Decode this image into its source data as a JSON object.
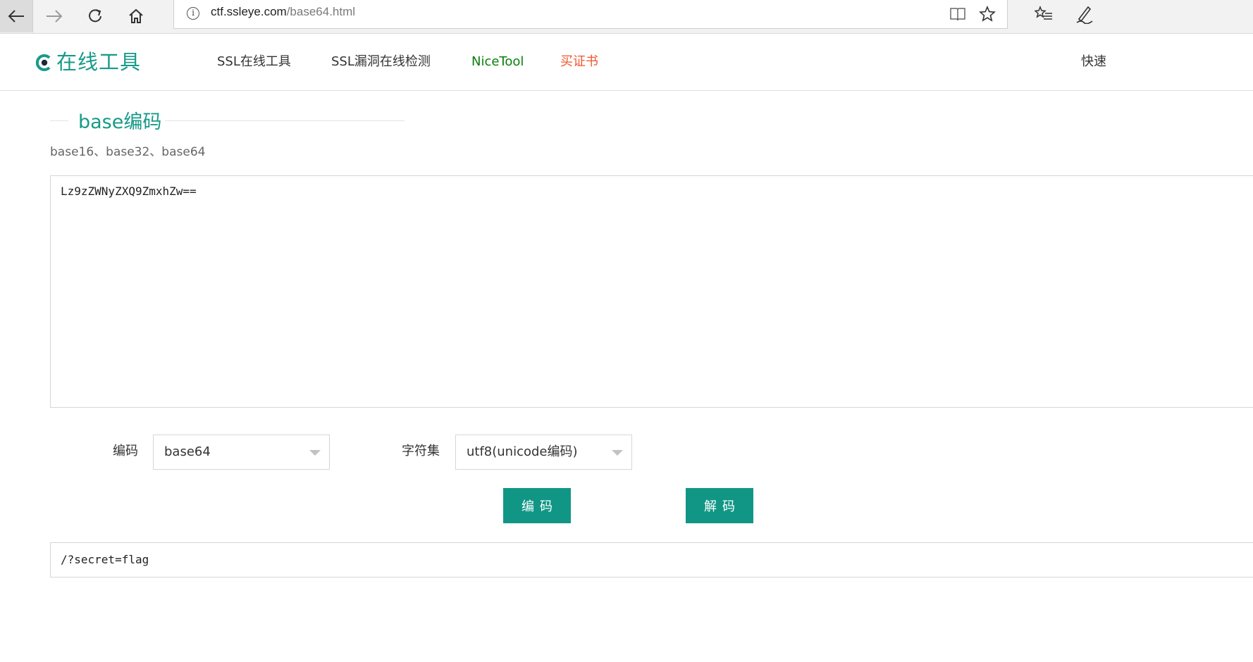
{
  "browser": {
    "url_host": "ctf.ssleye.com",
    "url_path": "/base64.html"
  },
  "site": {
    "logo_text": "在线工具",
    "nav": [
      {
        "label": "SSL在线工具",
        "color": "#333333"
      },
      {
        "label": "SSL漏洞在线检测",
        "color": "#333333"
      },
      {
        "label": "NiceTool",
        "color": "#0a7d0a"
      },
      {
        "label": "买证书",
        "color": "#f0562b"
      },
      {
        "label": "快速",
        "color": "#333333"
      }
    ],
    "brand_color": "#179a89"
  },
  "page": {
    "title": "base编码",
    "subtitle": "base16、base32、base64",
    "input_text": "Lz9zZWNyZXQ9ZmxhZw==",
    "encoding_label": "编码",
    "encoding_value": "base64",
    "charset_label": "字符集",
    "charset_value": "utf8(unicode编码)",
    "encode_button": "编码",
    "decode_button": "解码",
    "output_text": "/?secret=flag",
    "button_color": "#119686"
  }
}
